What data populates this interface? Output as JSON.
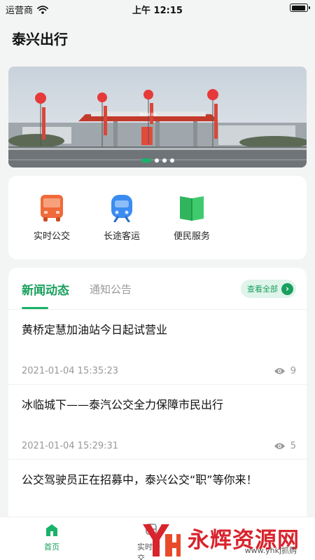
{
  "status_bar": {
    "carrier": "运营商",
    "time": "上午 12:15"
  },
  "header": {
    "title": "泰兴出行"
  },
  "banner": {
    "sign_text": "黄桥加油站",
    "slide_count": 4,
    "active_slide": 1
  },
  "services": [
    {
      "label": "实时公交",
      "icon": "bus-icon",
      "color": "#f06a3a"
    },
    {
      "label": "长途客运",
      "icon": "train-icon",
      "color": "#3a8cf0"
    },
    {
      "label": "便民服务",
      "icon": "book-icon",
      "color": "#2fb55c"
    }
  ],
  "news": {
    "tab_active": "新闻动态",
    "tab_inactive": "通知公告",
    "view_all": "查看全部",
    "items": [
      {
        "title": "黄桥定慧加油站今日起试营业",
        "date": "2021-01-04 15:35:23",
        "views": "9"
      },
      {
        "title": "冰临城下——泰汽公交全力保障市民出行",
        "date": "2021-01-04 15:29:31",
        "views": "5"
      },
      {
        "title": "公交驾驶员正在招募中，泰兴公交“职”等你来！",
        "date": "",
        "views": ""
      }
    ]
  },
  "bottom_nav": {
    "home": "首页",
    "second": "实时公交"
  },
  "watermark": {
    "text": "永辉资源网",
    "url": "www.yhkj抓购"
  },
  "colors": {
    "accent": "#19a05e",
    "background": "#f3f5f4"
  }
}
